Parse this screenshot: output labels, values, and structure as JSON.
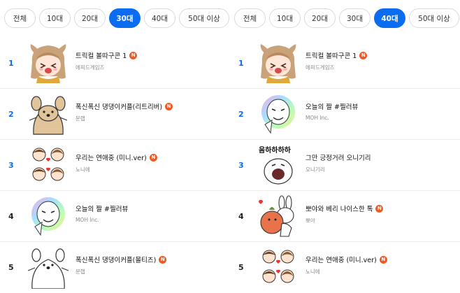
{
  "colors": {
    "accent": "#0a6cf0",
    "new_badge": "#f25a24"
  },
  "left": {
    "tabs": [
      {
        "label": "전체",
        "active": false
      },
      {
        "label": "10대",
        "active": false
      },
      {
        "label": "20대",
        "active": false
      },
      {
        "label": "30대",
        "active": true
      },
      {
        "label": "40대",
        "active": false
      },
      {
        "label": "50대 이상",
        "active": false
      }
    ],
    "items": [
      {
        "rank": "1",
        "title": "트릭컬 볼따구콘 1",
        "author": "에피드게임즈",
        "new": "N",
        "icon": "anime-girl-sticker-icon"
      },
      {
        "rank": "2",
        "title": "폭신폭신 댕댕이커플(리트리버)",
        "author": "문랩",
        "new": "N",
        "icon": "puppy-sticker-icon"
      },
      {
        "rank": "3",
        "title": "우리는 연애중 (미니.ver)",
        "author": "노니에",
        "new": "N",
        "icon": "couple-sticker-icon"
      },
      {
        "rank": "4",
        "title": "오늘의 짤 #찔러뷰",
        "author": "MOH Inc.",
        "new": "",
        "icon": "meme-face-sticker-icon"
      },
      {
        "rank": "5",
        "title": "폭신폭신 댕댕이커플(몰티즈)",
        "author": "문랩",
        "new": "N",
        "icon": "maltese-sticker-icon"
      }
    ]
  },
  "right": {
    "tabs": [
      {
        "label": "전체",
        "active": false
      },
      {
        "label": "10대",
        "active": false
      },
      {
        "label": "20대",
        "active": false
      },
      {
        "label": "30대",
        "active": false
      },
      {
        "label": "40대",
        "active": true
      },
      {
        "label": "50대 이상",
        "active": false
      }
    ],
    "items": [
      {
        "rank": "1",
        "title": "트릭컬 볼따구콘 1",
        "author": "에피드게임즈",
        "new": "N",
        "icon": "anime-girl-sticker-icon"
      },
      {
        "rank": "2",
        "title": "오늘의 짤 #찔러뷰",
        "author": "MOH Inc.",
        "new": "",
        "icon": "meme-face-sticker-icon"
      },
      {
        "rank": "3",
        "title": "그만 긍정거려 오니기리",
        "author": "오니기리",
        "new": "",
        "icon": "onigiri-laugh-sticker-icon",
        "thumb_text": "음하하하하"
      },
      {
        "rank": "4",
        "title": "뽀야와 베리 나이스한 톡",
        "author": "뽀야",
        "new": "N",
        "icon": "bunny-hug-sticker-icon"
      },
      {
        "rank": "5",
        "title": "우리는 연애중 (미니.ver)",
        "author": "노니에",
        "new": "N",
        "icon": "couple-sticker-icon"
      }
    ]
  }
}
